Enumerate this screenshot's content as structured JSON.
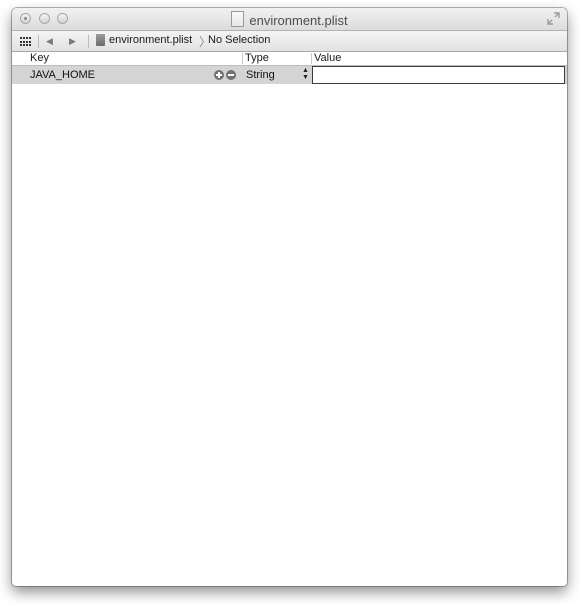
{
  "window": {
    "title": "environment.plist",
    "controls": [
      "close-button",
      "minimize-button",
      "zoom-button",
      "fullscreen-button"
    ]
  },
  "pathbar": {
    "icons": [
      "grid-icon",
      "back-arrow-icon",
      "forward-arrow-icon",
      "document-icon"
    ],
    "file": "environment.plist",
    "separator": "〉",
    "selection": "No Selection"
  },
  "columns": {
    "key": "Key",
    "type": "Type",
    "value": "Value"
  },
  "rows": [
    {
      "key": "JAVA_HOME",
      "type": "String",
      "value": "",
      "selected": true
    }
  ],
  "colors": {
    "selected_row": "#d4d4d4",
    "titlebar_top": "#f2f2f2",
    "titlebar_bottom": "#dcdcdc"
  }
}
